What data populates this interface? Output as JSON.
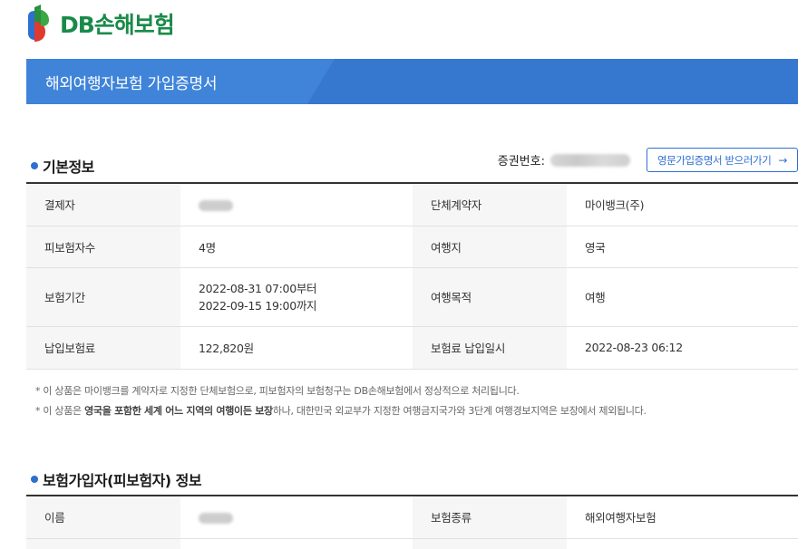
{
  "brand": {
    "logo_text": "DB손해보험"
  },
  "banner": {
    "title": "해외여행자보험 가입증명서"
  },
  "basic_section": {
    "title": "기본정보",
    "certificate_label": "증권번호:",
    "english_button": "영문가입증명서 받으러가기"
  },
  "basic_rows": [
    {
      "label1": "결제자",
      "value1": "",
      "label2": "단체계약자",
      "value2": "마이뱅크(주)"
    },
    {
      "label1": "피보험자수",
      "value1": "4명",
      "label2": "여행지",
      "value2": "영국"
    },
    {
      "label1": "보험기간",
      "value1_line1": "2022-08-31 07:00부터",
      "value1_line2": "2022-09-15 19:00까지",
      "label2": "여행목적",
      "value2": "여행"
    },
    {
      "label1": "납입보험료",
      "value1": "122,820원",
      "label2": "보험료 납입일시",
      "value2": "2022-08-23 06:12"
    }
  ],
  "notes": {
    "note1": "* 이 상품은 마이뱅크를 계약자로 지정한 단체보험으로, 피보험자의 보험청구는 DB손해보험에서 정상적으로 처리됩니다.",
    "note2_prefix": "* 이 상품은 ",
    "note2_bold": "영국을 포함한 세계 어느 지역의 여행이든 보장",
    "note2_suffix": "하나, 대한민국 외교부가 지정한 여행금지국가와 3단계 여행경보지역은 보장에서 제외됩니다."
  },
  "insured_section": {
    "title": "보험가입자(피보험자) 정보"
  },
  "insured_rows": [
    {
      "label1": "이름",
      "value1": "",
      "label2": "보험종류",
      "value2": "해외여행자보험"
    }
  ],
  "colors": {
    "accent": "#3b7fd4",
    "brand_green": "#1a8a4a",
    "dot": "#2f6fd1"
  }
}
